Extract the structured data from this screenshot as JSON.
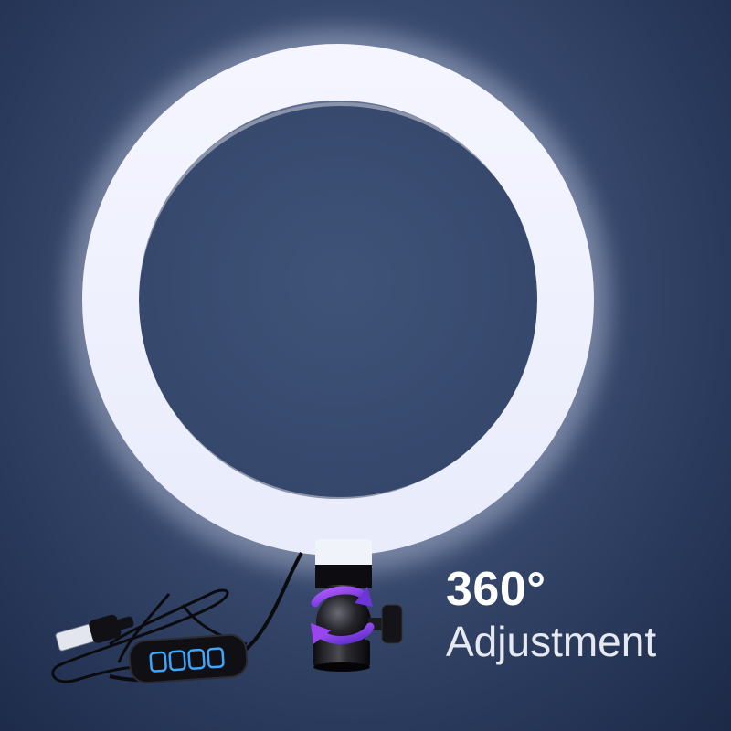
{
  "caption": {
    "headline": "360°",
    "subline": "Adjustment"
  },
  "colors": {
    "background": "#34466a",
    "ring_light": "#f2f4ff",
    "rotation_arrow": "#8a3dd8",
    "controller_buttons": "#3da7ff"
  },
  "icons": {
    "rotation": "rotation-arrow-icon"
  }
}
